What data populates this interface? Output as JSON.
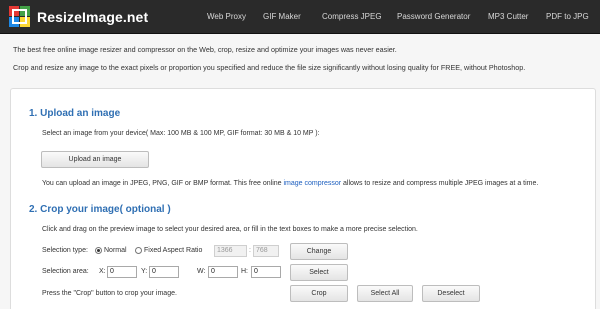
{
  "header": {
    "brand": "ResizeImage.net",
    "nav": [
      "Web Proxy",
      "GIF Maker",
      "Compress JPEG",
      "Password Generator",
      "MP3 Cutter",
      "PDF to JPG"
    ]
  },
  "intro": {
    "line1": "The best free online image resizer and compressor on the Web, crop, resize and optimize your images was never easier.",
    "line2": "Crop and resize any image to the exact pixels or proportion you specified and reduce the file size significantly without losing quality for FREE, without Photoshop."
  },
  "upload": {
    "heading": "1. Upload an image",
    "instruction": "Select an image from your device( Max: 100 MB & 100 MP, GIF format: 30 MB & 10 MP ):",
    "button": "Upload an image",
    "note_before": "You can upload an image in JPEG, PNG, GIF or BMP format. This free online",
    "note_link": "image compressor",
    "note_after": "allows to resize and compress multiple JPEG images at a time."
  },
  "crop": {
    "heading": "2. Crop your image( optional )",
    "instruction": "Click and drag on the preview image to select your desired area, or fill in the text boxes to make a more precise selection.",
    "selection_type_label": "Selection type:",
    "option_normal": "Normal",
    "option_fixed": "Fixed Aspect Ratio",
    "ratio_width": "1366",
    "ratio_height": "768",
    "ratio_separator": ":",
    "change_button": "Change",
    "selection_area_label": "Selection area:",
    "x_label": "X:",
    "x_value": "0",
    "y_label": "Y:",
    "y_value": "0",
    "w_label": "W:",
    "w_value": "0",
    "h_label": "H:",
    "h_value": "0",
    "select_button": "Select",
    "crop_hint": "Press the \"Crop\" button to crop your image.",
    "crop_button": "Crop",
    "select_all_button": "Select All",
    "deselect_button": "Deselect"
  }
}
